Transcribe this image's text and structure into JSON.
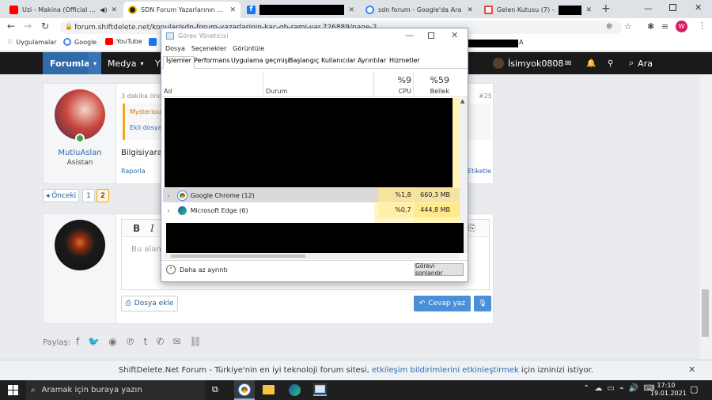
{
  "browser": {
    "tabs": [
      {
        "title": "Uzi - Makina (Official Vide",
        "favicon": "youtube-icon"
      },
      {
        "title": "SDN Forum Yazarlarının Kaç G",
        "favicon": "sdn-icon"
      },
      {
        "title": "",
        "favicon": "facebook-icon"
      },
      {
        "title": "sdn forum - Google'da Ara",
        "favicon": "google-icon"
      },
      {
        "title": "Gelen Kutusu (7) -",
        "favicon": "gmail-icon"
      }
    ],
    "url": "forum.shiftdelete.net/konular/sdn-forum-yazarlarinin-kac-gb-rami-var.726889/page-2",
    "bookmarks": [
      "Uygulamalar",
      "Google",
      "YouTube"
    ],
    "profile_initial": "W"
  },
  "site_nav": {
    "forums": "Forumlar",
    "media": "Medya",
    "user": "İsimyok0808",
    "search": "Ara"
  },
  "post": {
    "time": "3 dakika önce",
    "number": "#25",
    "author": "MutluAslan",
    "role": "Asistan",
    "quote_title": "Mysterious",
    "quote_text": "Ekli dosya",
    "body": "Bilgisiyara",
    "report": "Raporla",
    "tag": "Etiketle"
  },
  "pagination": {
    "prev": "◂ Önceki",
    "pages": [
      "1",
      "2"
    ],
    "current": "2"
  },
  "reply": {
    "placeholder": "Bu alanı",
    "attach": "Dosya ekle",
    "send": "Cevap yaz"
  },
  "share_label": "Paylaş:",
  "notification": {
    "before": "ShiftDelete.Net Forum - Türkiye'nin en iyi teknoloji forum sitesi, ",
    "link": "etkileşim bildirimlerini etkinleştirmek",
    "after": " için izninizi istiyor."
  },
  "task_manager": {
    "title": "Görev Yöneticisi",
    "menu": [
      "Dosya",
      "Seçenekler",
      "Görüntüle"
    ],
    "tabs": [
      "İşlemler",
      "Performans",
      "Uygulama geçmişi",
      "Başlangıç",
      "Kullanıcılar",
      "Ayrıntılar",
      "Hizmetler"
    ],
    "col_name": "Ad",
    "col_status": "Durum",
    "cpu_total": "%9",
    "cpu_label": "CPU",
    "mem_total": "%59",
    "mem_label": "Bellek",
    "rows": [
      {
        "name": "Google Chrome (12)",
        "cpu": "%1,8",
        "mem": "660,3 MB"
      },
      {
        "name": "Microsoft Edge (6)",
        "cpu": "%0,7",
        "mem": "444,8 MB"
      }
    ],
    "less_details": "Daha az ayrıntı",
    "end_task": "Görevi sonlandır"
  },
  "taskbar": {
    "search_placeholder": "Aramak için buraya yazın",
    "time": "17:10",
    "date": "19.01.2021"
  }
}
